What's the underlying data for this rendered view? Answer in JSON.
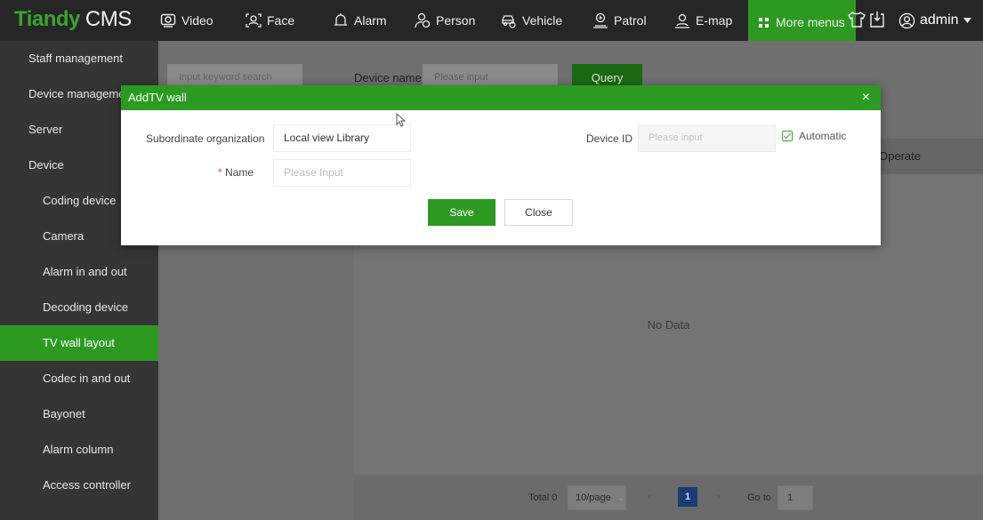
{
  "topbar": {
    "logo": "Tiandy",
    "logo_suffix": "CMS",
    "nav": [
      {
        "label": "Video",
        "icon": "video-camera-icon"
      },
      {
        "label": "Face",
        "icon": "face-scan-icon"
      },
      {
        "label": "Alarm",
        "icon": "alarm-bell-icon"
      },
      {
        "label": "Person",
        "icon": "person-icon"
      },
      {
        "label": "Vehicle",
        "icon": "vehicle-icon"
      },
      {
        "label": "Patrol",
        "icon": "patrol-icon"
      },
      {
        "label": "E-map",
        "icon": "map-pin-icon"
      },
      {
        "label": "More menus",
        "icon": "grid-icon"
      }
    ],
    "user": "admin",
    "accent": "#2c9a21"
  },
  "sidebar": {
    "items": [
      {
        "label": "Staff management",
        "level": "top"
      },
      {
        "label": "Device management",
        "level": "top"
      },
      {
        "label": "Server",
        "level": "top"
      },
      {
        "label": "Device",
        "level": "top"
      },
      {
        "label": "Coding device",
        "level": "sub"
      },
      {
        "label": "Camera",
        "level": "sub"
      },
      {
        "label": "Alarm in and out",
        "level": "sub"
      },
      {
        "label": "Decoding device",
        "level": "sub"
      },
      {
        "label": "TV wall layout",
        "level": "sub",
        "active": true
      },
      {
        "label": "Codec in and out",
        "level": "sub"
      },
      {
        "label": "Bayonet",
        "level": "sub"
      },
      {
        "label": "Alarm column",
        "level": "sub"
      },
      {
        "label": "Access controller",
        "level": "sub"
      }
    ]
  },
  "main": {
    "keyword_placeholder": "Input keyword search",
    "device_name_label": "Device name",
    "device_name_placeholder": "Please input",
    "query_label": "Query",
    "column_operate": "Operate",
    "no_data": "No Data"
  },
  "pagination": {
    "total": "Total 0",
    "page_size": "10/page",
    "current_page": "1",
    "goto_label": "Go to",
    "goto_value": "1"
  },
  "dialog": {
    "title": "AddTV wall",
    "org_label": "Subordinate organization",
    "org_value": "Local view Library",
    "name_label": "Name",
    "name_required": "*",
    "name_placeholder": "Please Input",
    "device_id_label": "Device ID",
    "device_id_placeholder": "Please input",
    "automatic_label": "Automatic",
    "automatic_checked": true,
    "save_label": "Save",
    "close_label": "Close"
  }
}
